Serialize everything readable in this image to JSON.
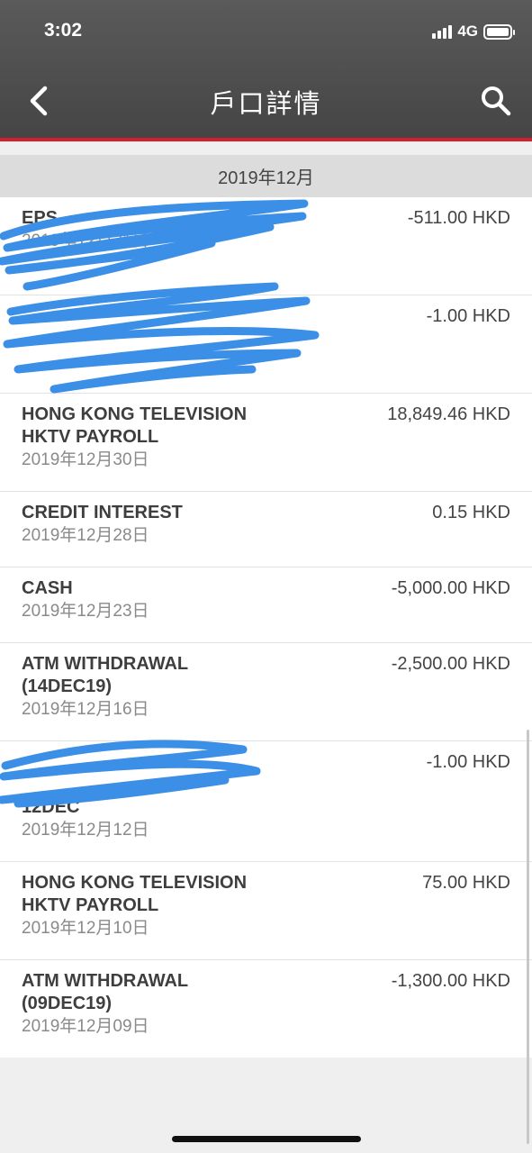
{
  "status_bar": {
    "time": "3:02",
    "network": "4G"
  },
  "header": {
    "title": "戶口詳情"
  },
  "month": {
    "label": "2019年12月"
  },
  "transactions": [
    {
      "desc1": "EPS",
      "desc2": "",
      "date": "2019年12月31日",
      "amount": "-511.00 HKD"
    },
    {
      "desc1": "",
      "desc2": "",
      "date": "",
      "amount": "-1.00 HKD"
    },
    {
      "desc1": "HONG KONG TELEVISION",
      "desc2": "HKTV PAYROLL",
      "date": "2019年12月30日",
      "amount": "18,849.46 HKD"
    },
    {
      "desc1": "CREDIT INTEREST",
      "desc2": "",
      "date": "2019年12月28日",
      "amount": "0.15 HKD"
    },
    {
      "desc1": "CASH",
      "desc2": "",
      "date": "2019年12月23日",
      "amount": "-5,000.00 HKD"
    },
    {
      "desc1": "ATM WITHDRAWAL",
      "desc2": "(14DEC19)",
      "date": "2019年12月16日",
      "amount": "-2,500.00 HKD"
    },
    {
      "desc1": "",
      "desc2": "12DEC",
      "date": "2019年12月12日",
      "amount": "-1.00 HKD"
    },
    {
      "desc1": "HONG KONG TELEVISION",
      "desc2": "HKTV PAYROLL",
      "date": "2019年12月10日",
      "amount": "75.00 HKD"
    },
    {
      "desc1": "ATM WITHDRAWAL",
      "desc2": "(09DEC19)",
      "date": "2019年12月09日",
      "amount": "-1,300.00 HKD"
    }
  ],
  "colors": {
    "header_bg": "#4f4f4f",
    "accent_red": "#d3202f",
    "redaction_blue": "#3b8fe6"
  },
  "icons": {
    "back": "chevron-left-icon",
    "search": "search-icon"
  }
}
